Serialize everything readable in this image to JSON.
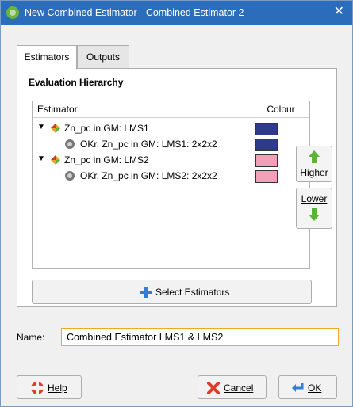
{
  "window": {
    "title": "New Combined Estimator - Combined Estimator 2",
    "close_glyph": "✕"
  },
  "tabs": [
    {
      "label": "Estimators",
      "active": true
    },
    {
      "label": "Outputs",
      "active": false
    }
  ],
  "hierarchy": {
    "section_title": "Evaluation Hierarchy",
    "columns": {
      "estimator": "Estimator",
      "colour": "Colour"
    },
    "rows": [
      {
        "label": "Zn_pc in GM: LMS1",
        "level": 0,
        "icon": "combined-estimator-icon",
        "colour": "#2e3a8c"
      },
      {
        "label": "OKr, Zn_pc in GM: LMS1: 2x2x2",
        "level": 1,
        "icon": "kriging-estimator-icon",
        "colour": "#2e3a8c"
      },
      {
        "label": "Zn_pc in GM: LMS2",
        "level": 0,
        "icon": "combined-estimator-icon",
        "colour": "#f4a0b8"
      },
      {
        "label": "OKr, Zn_pc in GM: LMS2: 2x2x2",
        "level": 1,
        "icon": "kriging-estimator-icon",
        "colour": "#f4a0b8"
      }
    ]
  },
  "side_buttons": {
    "higher": "Higher",
    "lower": "Lower"
  },
  "select_button": "Select Estimators",
  "name": {
    "label": "Name:",
    "value": "Combined Estimator LMS1 & LMS2"
  },
  "buttons": {
    "help": "Help",
    "cancel": "Cancel",
    "ok": "OK"
  },
  "colors": {
    "title_bar": "#2b6dbb",
    "focus_border": "#f5a623",
    "arrow_green": "#5cb338"
  }
}
